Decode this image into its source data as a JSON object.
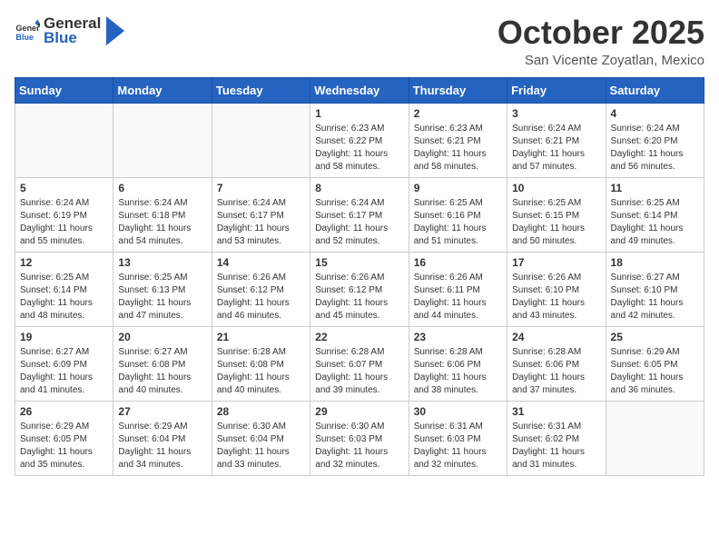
{
  "header": {
    "logo_general": "General",
    "logo_blue": "Blue",
    "title": "October 2025",
    "subtitle": "San Vicente Zoyatlan, Mexico"
  },
  "weekdays": [
    "Sunday",
    "Monday",
    "Tuesday",
    "Wednesday",
    "Thursday",
    "Friday",
    "Saturday"
  ],
  "weeks": [
    [
      {
        "day": "",
        "info": ""
      },
      {
        "day": "",
        "info": ""
      },
      {
        "day": "",
        "info": ""
      },
      {
        "day": "1",
        "info": "Sunrise: 6:23 AM\nSunset: 6:22 PM\nDaylight: 11 hours\nand 58 minutes."
      },
      {
        "day": "2",
        "info": "Sunrise: 6:23 AM\nSunset: 6:21 PM\nDaylight: 11 hours\nand 58 minutes."
      },
      {
        "day": "3",
        "info": "Sunrise: 6:24 AM\nSunset: 6:21 PM\nDaylight: 11 hours\nand 57 minutes."
      },
      {
        "day": "4",
        "info": "Sunrise: 6:24 AM\nSunset: 6:20 PM\nDaylight: 11 hours\nand 56 minutes."
      }
    ],
    [
      {
        "day": "5",
        "info": "Sunrise: 6:24 AM\nSunset: 6:19 PM\nDaylight: 11 hours\nand 55 minutes."
      },
      {
        "day": "6",
        "info": "Sunrise: 6:24 AM\nSunset: 6:18 PM\nDaylight: 11 hours\nand 54 minutes."
      },
      {
        "day": "7",
        "info": "Sunrise: 6:24 AM\nSunset: 6:17 PM\nDaylight: 11 hours\nand 53 minutes."
      },
      {
        "day": "8",
        "info": "Sunrise: 6:24 AM\nSunset: 6:17 PM\nDaylight: 11 hours\nand 52 minutes."
      },
      {
        "day": "9",
        "info": "Sunrise: 6:25 AM\nSunset: 6:16 PM\nDaylight: 11 hours\nand 51 minutes."
      },
      {
        "day": "10",
        "info": "Sunrise: 6:25 AM\nSunset: 6:15 PM\nDaylight: 11 hours\nand 50 minutes."
      },
      {
        "day": "11",
        "info": "Sunrise: 6:25 AM\nSunset: 6:14 PM\nDaylight: 11 hours\nand 49 minutes."
      }
    ],
    [
      {
        "day": "12",
        "info": "Sunrise: 6:25 AM\nSunset: 6:14 PM\nDaylight: 11 hours\nand 48 minutes."
      },
      {
        "day": "13",
        "info": "Sunrise: 6:25 AM\nSunset: 6:13 PM\nDaylight: 11 hours\nand 47 minutes."
      },
      {
        "day": "14",
        "info": "Sunrise: 6:26 AM\nSunset: 6:12 PM\nDaylight: 11 hours\nand 46 minutes."
      },
      {
        "day": "15",
        "info": "Sunrise: 6:26 AM\nSunset: 6:12 PM\nDaylight: 11 hours\nand 45 minutes."
      },
      {
        "day": "16",
        "info": "Sunrise: 6:26 AM\nSunset: 6:11 PM\nDaylight: 11 hours\nand 44 minutes."
      },
      {
        "day": "17",
        "info": "Sunrise: 6:26 AM\nSunset: 6:10 PM\nDaylight: 11 hours\nand 43 minutes."
      },
      {
        "day": "18",
        "info": "Sunrise: 6:27 AM\nSunset: 6:10 PM\nDaylight: 11 hours\nand 42 minutes."
      }
    ],
    [
      {
        "day": "19",
        "info": "Sunrise: 6:27 AM\nSunset: 6:09 PM\nDaylight: 11 hours\nand 41 minutes."
      },
      {
        "day": "20",
        "info": "Sunrise: 6:27 AM\nSunset: 6:08 PM\nDaylight: 11 hours\nand 40 minutes."
      },
      {
        "day": "21",
        "info": "Sunrise: 6:28 AM\nSunset: 6:08 PM\nDaylight: 11 hours\nand 40 minutes."
      },
      {
        "day": "22",
        "info": "Sunrise: 6:28 AM\nSunset: 6:07 PM\nDaylight: 11 hours\nand 39 minutes."
      },
      {
        "day": "23",
        "info": "Sunrise: 6:28 AM\nSunset: 6:06 PM\nDaylight: 11 hours\nand 38 minutes."
      },
      {
        "day": "24",
        "info": "Sunrise: 6:28 AM\nSunset: 6:06 PM\nDaylight: 11 hours\nand 37 minutes."
      },
      {
        "day": "25",
        "info": "Sunrise: 6:29 AM\nSunset: 6:05 PM\nDaylight: 11 hours\nand 36 minutes."
      }
    ],
    [
      {
        "day": "26",
        "info": "Sunrise: 6:29 AM\nSunset: 6:05 PM\nDaylight: 11 hours\nand 35 minutes."
      },
      {
        "day": "27",
        "info": "Sunrise: 6:29 AM\nSunset: 6:04 PM\nDaylight: 11 hours\nand 34 minutes."
      },
      {
        "day": "28",
        "info": "Sunrise: 6:30 AM\nSunset: 6:04 PM\nDaylight: 11 hours\nand 33 minutes."
      },
      {
        "day": "29",
        "info": "Sunrise: 6:30 AM\nSunset: 6:03 PM\nDaylight: 11 hours\nand 32 minutes."
      },
      {
        "day": "30",
        "info": "Sunrise: 6:31 AM\nSunset: 6:03 PM\nDaylight: 11 hours\nand 32 minutes."
      },
      {
        "day": "31",
        "info": "Sunrise: 6:31 AM\nSunset: 6:02 PM\nDaylight: 11 hours\nand 31 minutes."
      },
      {
        "day": "",
        "info": ""
      }
    ]
  ]
}
